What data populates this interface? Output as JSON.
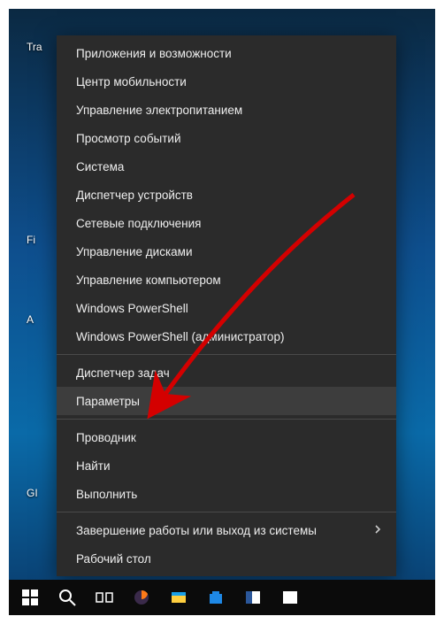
{
  "desktop_labels": {
    "l1": "Tra",
    "l2": "Fi",
    "l3": "A",
    "l4": "GI"
  },
  "menu": {
    "g1": [
      "Приложения и возможности",
      "Центр мобильности",
      "Управление электропитанием",
      "Просмотр событий",
      "Система",
      "Диспетчер устройств",
      "Сетевые подключения",
      "Управление дисками",
      "Управление компьютером",
      "Windows PowerShell",
      "Windows PowerShell (администратор)"
    ],
    "g2": [
      "Диспетчер задач",
      "Параметры"
    ],
    "g3": [
      "Проводник",
      "Найти",
      "Выполнить"
    ],
    "g4": [
      {
        "label": "Завершение работы или выход из системы",
        "submenu": true
      },
      {
        "label": "Рабочий стол",
        "submenu": false
      }
    ],
    "hovered_index": 1
  },
  "annotation": {
    "target": "Параметры"
  }
}
